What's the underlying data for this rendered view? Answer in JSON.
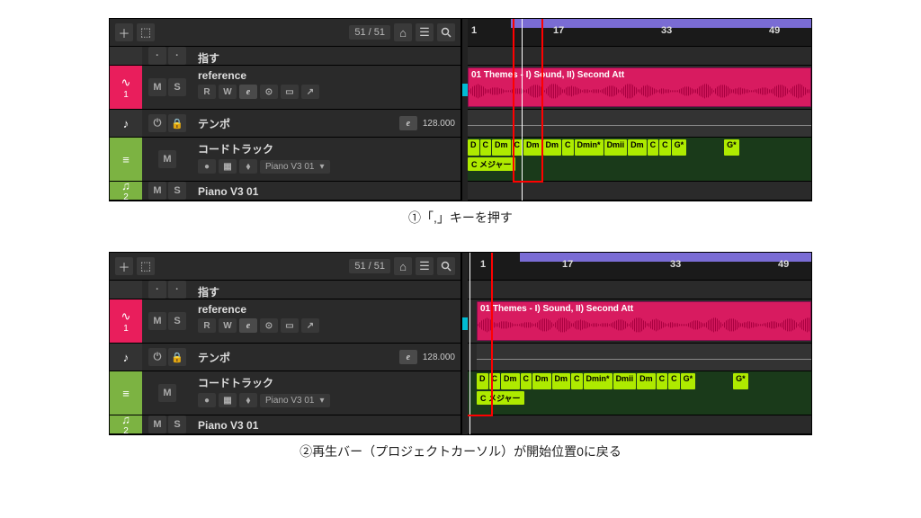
{
  "captions": {
    "c1": "①「,」キーを押す",
    "c2": "②再生バー（プロジェクトカーソル）が開始位置0に戻る"
  },
  "toolbar": {
    "counter": "51 / 51"
  },
  "ruler": {
    "m1": "1",
    "m17": "17",
    "m33": "33",
    "m49": "49"
  },
  "tracks": {
    "t0": {
      "name": "指す"
    },
    "reference": {
      "name": "reference",
      "r": "R",
      "w": "W",
      "e": "e",
      "idx": "1"
    },
    "tempo": {
      "name": "テンポ",
      "value": "128.000"
    },
    "chord": {
      "name": "コードトラック",
      "inst": "Piano V3 01"
    },
    "piano": {
      "name": "Piano V3 01",
      "idx": "2"
    },
    "ms": {
      "m": "M",
      "s": "S"
    }
  },
  "clip": {
    "title": "01 Themes - I) Sound, II) Second Att"
  },
  "chords": {
    "list": [
      "D",
      "C",
      "Dm",
      "C",
      "Dm",
      "Dm",
      "C",
      "Dmin*",
      "Dmii",
      "Dm",
      "C",
      "C",
      "G*"
    ],
    "last": "G*",
    "scale": "C メジャー"
  }
}
